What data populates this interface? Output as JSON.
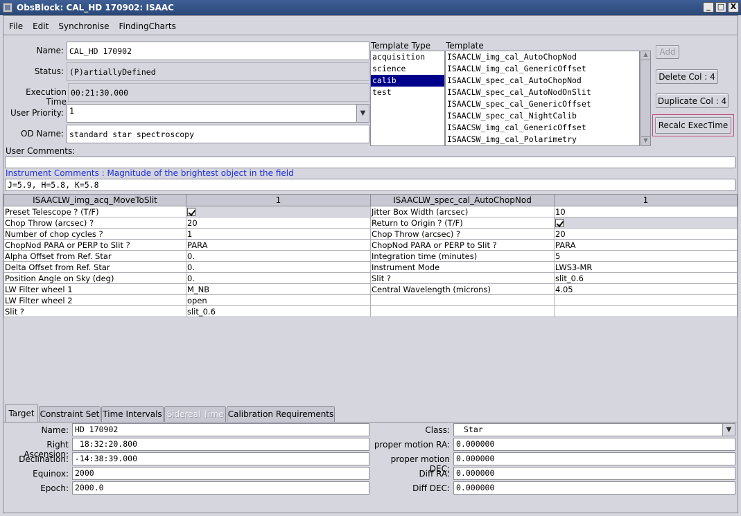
{
  "window": {
    "title": "ObsBlock: CAL_HD 170902: ISAAC",
    "controls": [
      "_",
      "□",
      "X"
    ]
  },
  "menu": [
    "File",
    "Edit",
    "Synchronise",
    "FindingCharts"
  ],
  "form": {
    "name_label": "Name:",
    "name_value": "CAL_HD 170902",
    "status_label": "Status:",
    "status_value": "(P)artiallyDefined",
    "exec_label": "Execution Time",
    "exec_value": "00:21:30.000",
    "priority_label": "User Priority:",
    "priority_value": "1",
    "od_label": "OD Name:",
    "od_value": "standard star spectroscopy",
    "user_comments_label": "User Comments:",
    "user_comments_value": "",
    "instr_comments_label": "Instrument Comments : Magnitude of the brightest object in the field",
    "instr_comments_value": "J=5.9, H=5.8, K=5.8"
  },
  "template_type": {
    "header": "Template Type",
    "items": [
      "acquisition",
      "science",
      "calib",
      "test"
    ],
    "selected": "calib"
  },
  "template": {
    "header": "Template",
    "items": [
      "ISAACLW_img_cal_AutoChopNod",
      "ISAACLW_img_cal_GenericOffset",
      "ISAACLW_spec_cal_AutoChopNod",
      "ISAACLW_spec_cal_AutoNodOnSlit",
      "ISAACLW_spec_cal_GenericOffset",
      "ISAACLW_spec_cal_NightCalib",
      "ISAACSW_img_cal_GenericOffset",
      "ISAACSW_img_cal_Polarimetry"
    ]
  },
  "buttons": {
    "add": "Add",
    "delete_col": "Delete Col : 4",
    "duplicate_col": "Duplicate Col : 4",
    "recalc": "Recalc ExecTime"
  },
  "param_table": {
    "headers": [
      "ISAACLW_img_acq_MoveToSlit",
      "1",
      "ISAACLW_spec_cal_AutoChopNod",
      "1"
    ],
    "rows": [
      [
        "Preset Telescope ? (T/F)",
        "",
        "Jitter Box Width (arcsec)",
        "10"
      ],
      [
        "Chop Throw (arcsec) ?",
        "20",
        "Return to Origin ? (T/F)",
        ""
      ],
      [
        "Number of chop cycles ?",
        "1",
        "Chop Throw (arcsec) ?",
        "20"
      ],
      [
        "ChopNod PARA or PERP to Slit ?",
        "PARA",
        "ChopNod PARA or PERP to Slit ?",
        "PARA"
      ],
      [
        "Alpha Offset from Ref. Star",
        "0.",
        "Integration time (minutes)",
        "5"
      ],
      [
        "Delta Offset from  Ref. Star",
        "0.",
        "Instrument Mode",
        "LWS3-MR"
      ],
      [
        "Position Angle on Sky (deg)",
        "0.",
        "Slit ?",
        "slit_0.6"
      ],
      [
        "LW Filter wheel 1",
        "M_NB",
        "Central Wavelength (microns)",
        "4.05"
      ],
      [
        "LW Filter wheel 2",
        "open",
        "",
        ""
      ],
      [
        "Slit ?",
        "slit_0.6",
        "",
        ""
      ]
    ]
  },
  "tabs": [
    "Target",
    "Constraint Set",
    "Time Intervals",
    "Sidereal Time",
    "Calibration Requirements"
  ],
  "target": {
    "name_label": "Name:",
    "name_value": "HD 170902",
    "ra_label": "Right Ascension:",
    "ra_value": " 18:32:20.800",
    "dec_label": "Declination:",
    "dec_value": "-14:38:39.000",
    "equinox_label": "Equinox:",
    "equinox_value": "2000",
    "epoch_label": "Epoch:",
    "epoch_value": "2000.0",
    "class_label": "Class:",
    "class_value": "Star",
    "pmra_label": "proper motion RA:",
    "pmra_value": "0.000000",
    "pmdec_label": "proper motion DEC:",
    "pmdec_value": "0.000000",
    "diffra_label": "Diff RA:",
    "diffra_value": "0.000000",
    "diffdec_label": "Diff DEC:",
    "diffdec_value": "0.000000"
  }
}
